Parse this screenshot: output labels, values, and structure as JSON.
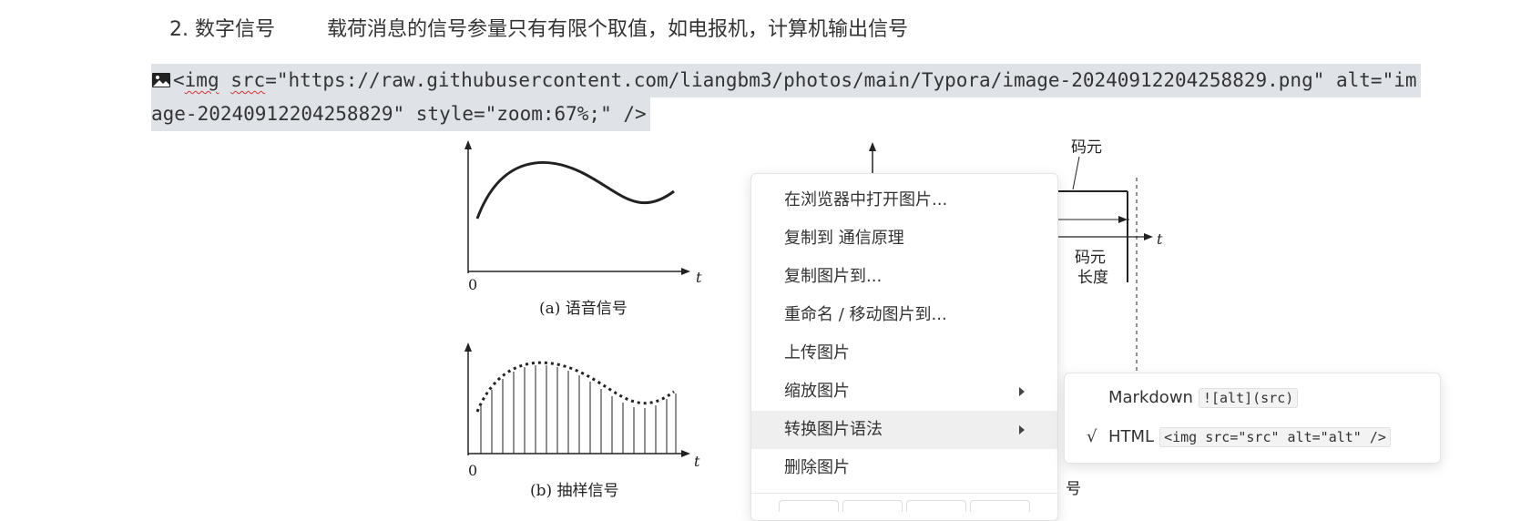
{
  "heading": {
    "number": "2. 数字信号",
    "text": "载荷消息的信号参量只有有限个取值，如电报机，计算机输出信号"
  },
  "code": {
    "line1_prefix": "<",
    "line1_tag": "img",
    "line1_space": " ",
    "line1_attr": "src",
    "line1_rest": "=\"https://raw.githubusercontent.com/liangbm3/photos/main/Typora/image-20240912204258829.png\" alt=\"im",
    "line2": "age-20240912204258829\" style=\"zoom:67%;\" />"
  },
  "figure": {
    "label_a": "(a) 语音信号",
    "label_b": "(b) 抽样信号",
    "zero_a": "0",
    "zero_b": "0",
    "t_a": "t",
    "t_b": "t",
    "t_c": "t",
    "code_element": "码元",
    "code_element2": "码元",
    "length": "长度",
    "partial_label": "号"
  },
  "context_menu": {
    "items": [
      {
        "label": "在浏览器中打开图片..."
      },
      {
        "label": "复制到 通信原理"
      },
      {
        "label": "复制图片到..."
      },
      {
        "label": "重命名 / 移动图片到..."
      },
      {
        "label": "上传图片"
      },
      {
        "label": "缩放图片"
      },
      {
        "label": "转换图片语法"
      },
      {
        "label": "删除图片"
      }
    ]
  },
  "submenu": {
    "markdown_label": "Markdown",
    "markdown_code": "![alt](src)",
    "html_check": "√",
    "html_label": "HTML",
    "html_code": "<img src=\"src\" alt=\"alt\" />"
  },
  "colors": {
    "selection_bg": "#dfe3e8",
    "menu_active_bg": "#efefef"
  }
}
